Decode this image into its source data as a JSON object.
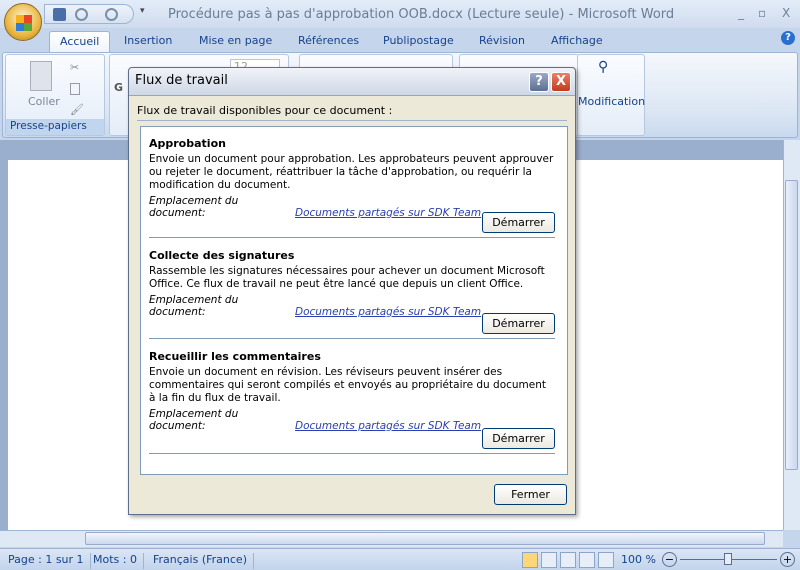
{
  "window": {
    "title": "Procédure pas à pas d'approbation OOB.docx (Lecture seule) - Microsoft Word",
    "minimize": "_",
    "restore": "▫",
    "close": "X"
  },
  "tabs": [
    {
      "label": "Accueil",
      "active": true
    },
    {
      "label": "Insertion"
    },
    {
      "label": "Mise en page"
    },
    {
      "label": "Références"
    },
    {
      "label": "Publipostage"
    },
    {
      "label": "Révision"
    },
    {
      "label": "Affichage"
    }
  ],
  "help": "?",
  "ribbon": {
    "paste_label": "Coller",
    "clipboard_group": "Presse-papiers",
    "font_size": "12",
    "bold": "G",
    "editing_label": "Modification"
  },
  "dialog": {
    "title": "Flux de travail",
    "help": "?",
    "close": "X",
    "label": "Flux de travail disponibles pour ce document :",
    "workflows": [
      {
        "name": "Approbation",
        "description": "Envoie un document pour approbation. Les approbateurs peuvent approuver ou rejeter le document, réattribuer la tâche d'approbation, ou requérir la modification du document.",
        "location_label": "Emplacement du document:",
        "location_link": "Documents partagés sur SDK Team",
        "start": "Démarrer"
      },
      {
        "name": "Collecte des signatures",
        "description": "Rassemble les signatures nécessaires pour achever un document Microsoft Office. Ce flux de travail ne peut être lancé que depuis un client Office.",
        "location_label": "Emplacement du document:",
        "location_link": "Documents partagés sur SDK Team",
        "start": "Démarrer"
      },
      {
        "name": "Recueillir les commentaires",
        "description": "Envoie un document en révision. Les réviseurs peuvent insérer des commentaires qui seront compilés et envoyés au propriétaire du document à la fin du flux de travail.",
        "location_label": "Emplacement du document:",
        "location_link": "Documents partagés sur SDK Team",
        "start": "Démarrer"
      }
    ],
    "close_button": "Fermer"
  },
  "status": {
    "page": "Page : 1 sur 1",
    "words": "Mots : 0",
    "language": "Français (France)",
    "zoom": "100 %",
    "zoom_minus": "−",
    "zoom_plus": "+"
  }
}
